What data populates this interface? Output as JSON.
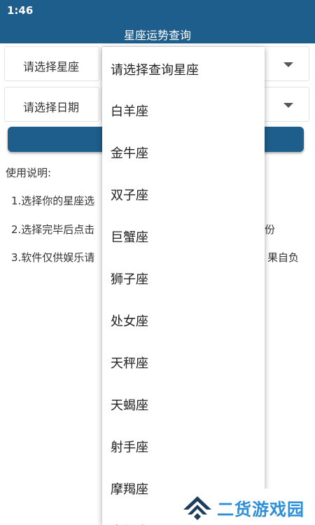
{
  "status_bar": {
    "time": "1:46"
  },
  "app_bar": {
    "title": "星座运势查询"
  },
  "form": {
    "constellation_label": "请选择星座",
    "date_label": "请选择日期"
  },
  "instructions": {
    "title": "使用说明:",
    "items": [
      "1.选择你的星座选",
      "2.选择完毕后点击",
      "3.软件仅供娱乐请"
    ],
    "tails": [
      "",
      "份",
      "果自负"
    ]
  },
  "dropdown": {
    "options": [
      "请选择查询星座",
      "白羊座",
      "金牛座",
      "双子座",
      "巨蟹座",
      "狮子座",
      "处女座",
      "天秤座",
      "天蝎座",
      "射手座",
      "摩羯座",
      "水瓶座"
    ]
  },
  "watermark": {
    "text": "二货游戏园"
  },
  "colors": {
    "primary": "#1d5e8c",
    "watermark": "#2b8ed8"
  }
}
